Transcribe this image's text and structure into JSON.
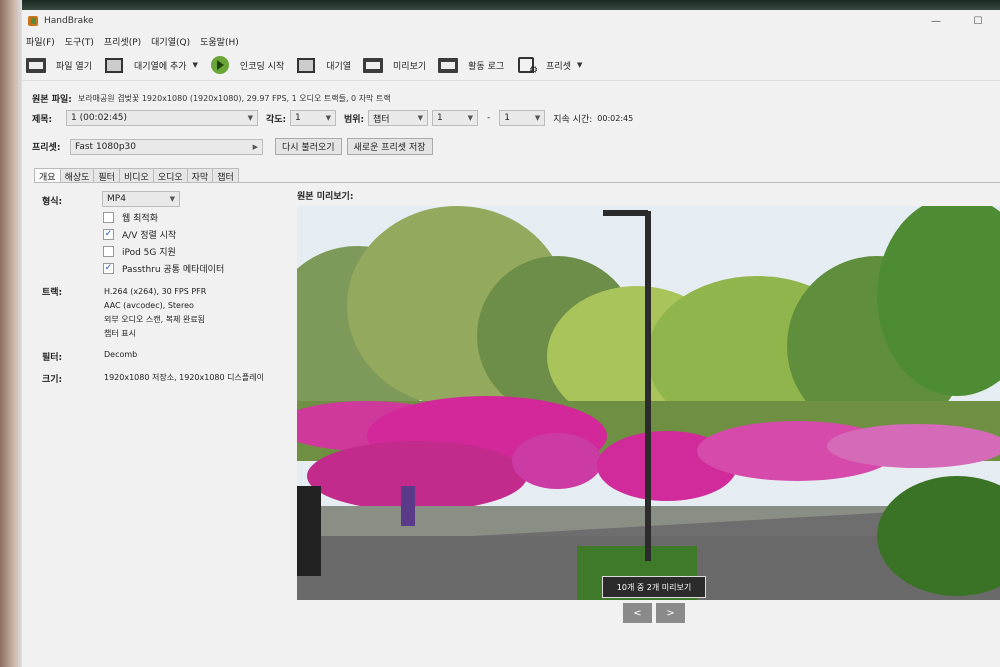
{
  "window": {
    "title": "HandBrake",
    "minimize": "—",
    "maximize": "☐"
  },
  "menu": [
    "파일(F)",
    "도구(T)",
    "프리셋(P)",
    "대기열(Q)",
    "도움말(H)"
  ],
  "toolbar": {
    "open": "파일 열기",
    "add_queue": "대기열에 추가",
    "start": "인코딩 시작",
    "queue": "대기열",
    "preview": "미리보기",
    "activity": "활동 로그",
    "presets": "프리셋"
  },
  "source": {
    "label": "원본 파일:",
    "value": "보라매공원 겹벚꽃   1920x1080 (1920x1080), 29.97 FPS, 1 오디오 트랙들, 0 자막 트랙"
  },
  "title_row": {
    "title_label": "제목:",
    "title_value": "1  (00:02:45)",
    "angle_label": "각도:",
    "angle_value": "1",
    "range_label": "범위:",
    "range_type": "챕터",
    "range_start": "1",
    "dash": "-",
    "range_end": "1",
    "duration_label": "지속 시간:",
    "duration_value": "00:02:45"
  },
  "preset_row": {
    "label": "프리셋:",
    "value": "Fast 1080p30",
    "reload": "다시 불러오기",
    "save_new": "새로운 프리셋 저장"
  },
  "tabs": [
    "개요",
    "해상도",
    "필터",
    "비디오",
    "오디오",
    "자막",
    "챕터"
  ],
  "summary": {
    "format_label": "형식:",
    "format_value": "MP4",
    "options": [
      {
        "label": "웹 최적화",
        "checked": false
      },
      {
        "label": "A/V 정렬 시작",
        "checked": true
      },
      {
        "label": "iPod 5G 지원",
        "checked": false
      },
      {
        "label": "Passthru 공통 메타데이터",
        "checked": true
      }
    ],
    "tracks_label": "트랙:",
    "tracks": [
      "H.264 (x264), 30 FPS PFR",
      "AAC (avcodec), Stereo",
      "외부 오디오 스캔, 복제 완료됨",
      "챕터 표시"
    ],
    "filters_label": "필터:",
    "filters_value": "Decomb",
    "size_label": "크기:",
    "size_value": "1920x1080 저장소, 1920x1080 디스플레이"
  },
  "preview": {
    "label": "원본 미리보기:",
    "caption": "10개 중 2개 미리보기",
    "prev": "<",
    "next": ">"
  }
}
